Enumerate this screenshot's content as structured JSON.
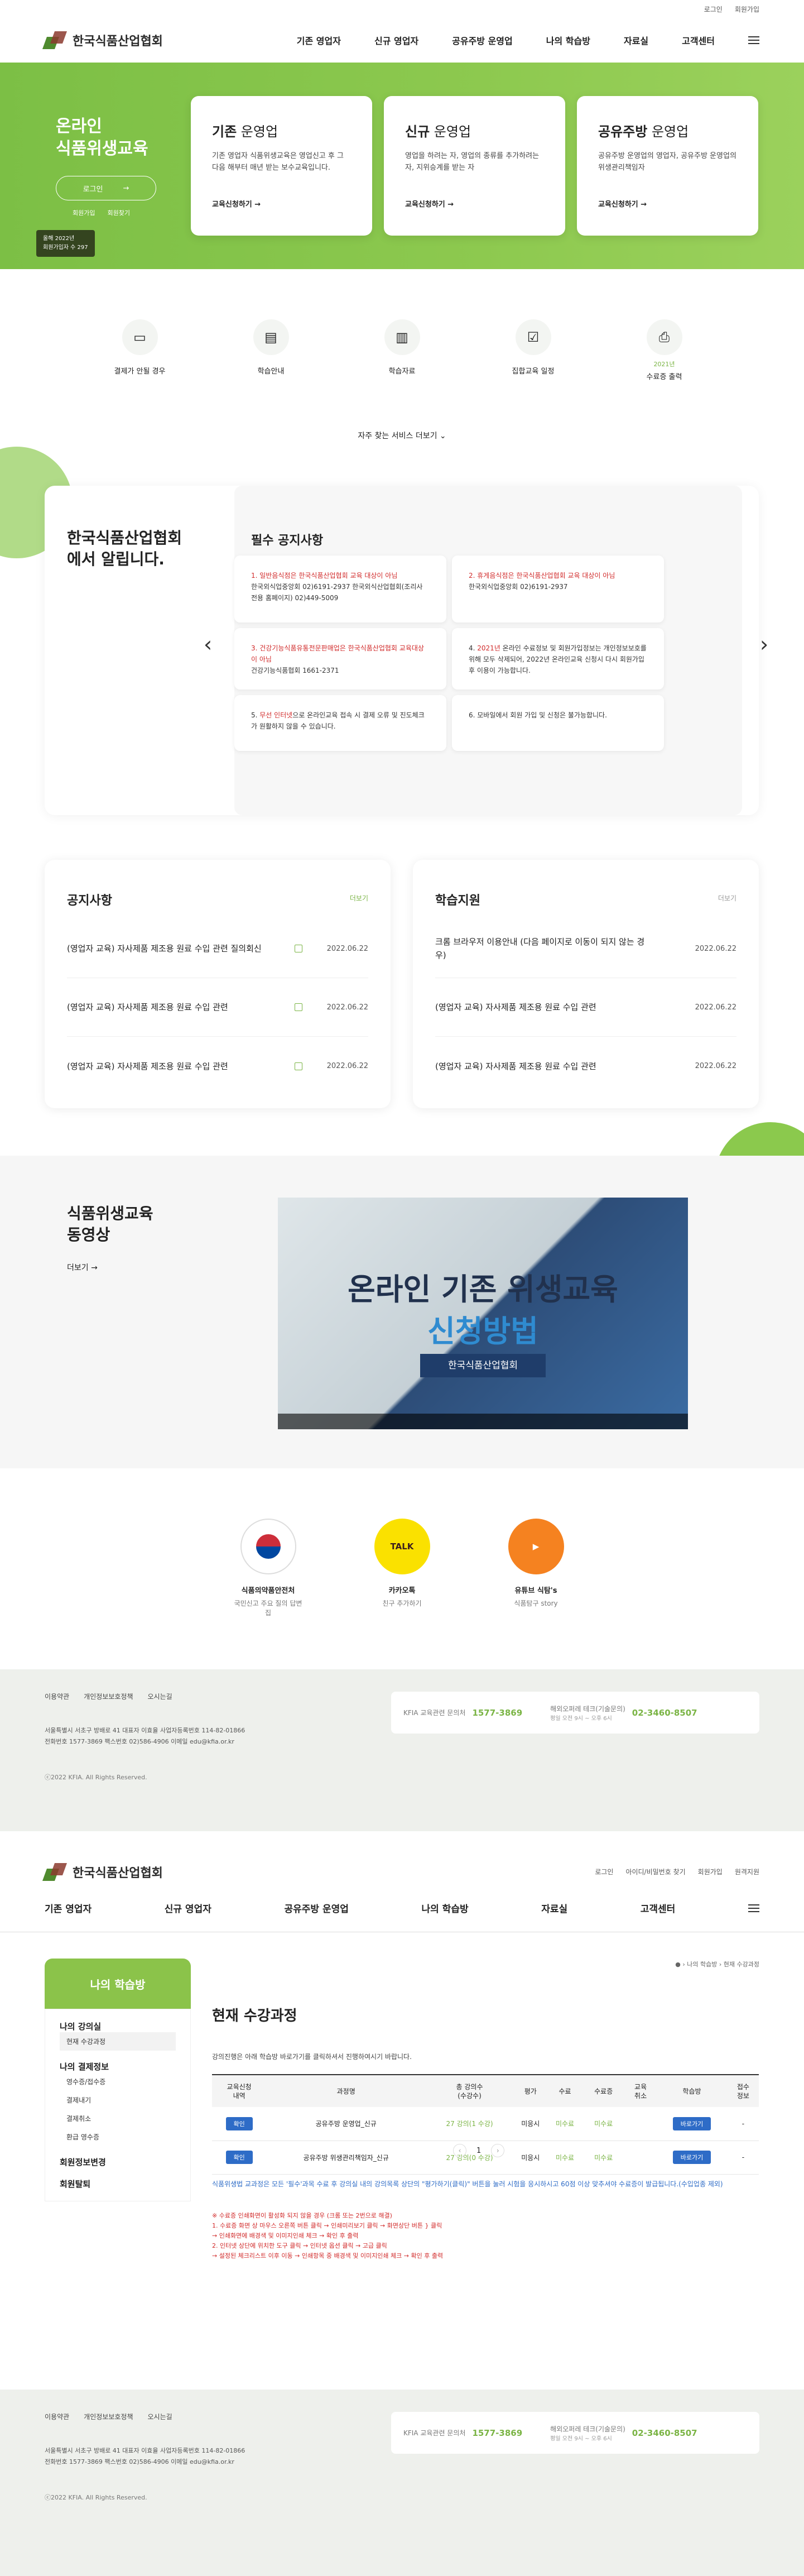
{
  "util": {
    "login": "로그인",
    "join": "회원가입"
  },
  "brand": {
    "name": "한국식품산업협회"
  },
  "gnb": [
    "기존 영업자",
    "신규 영업자",
    "공유주방 운영업",
    "나의 학습방",
    "자료실",
    "고객센터"
  ],
  "hero": {
    "title": "온라인\n식품위생교육",
    "login": "로그인",
    "links": [
      "회원가입",
      "회원찾기"
    ],
    "stat": "올해 2022년\n회원가입자 수 297",
    "cards": [
      {
        "title_b": "기존",
        "title_n": " 운영업",
        "desc": "기존 영업자 식품위생교육은 영업신고 후 그 다음 해부터 매년 받는 보수교육입니다.",
        "link": "교육신청하기 →"
      },
      {
        "title_b": "신규",
        "title_n": " 운영업",
        "desc": "영업을 하려는 자, 영업의 종류를 추가하려는 자, 지위승계를 받는 자",
        "link": "교육신청하기 →"
      },
      {
        "title_b": "공유주방",
        "title_n": " 운영업",
        "desc": "공유주방 운영업의 영업자, 공유주방 운영업의 위생관리책임자",
        "link": "교육신청하기 →"
      }
    ]
  },
  "quick": {
    "items": [
      {
        "label": "결제가 안될 경우",
        "icon": "chat-icon"
      },
      {
        "label": "학습안내",
        "icon": "notebook-icon"
      },
      {
        "label": "학습자료",
        "icon": "document-icon"
      },
      {
        "label": "집합교육 일정",
        "icon": "calendar-check-icon"
      },
      {
        "label": "수료증 출력",
        "icon": "printer-icon",
        "year": "2021년"
      }
    ],
    "more": "자주 찾는 서비스 더보기 ⌄"
  },
  "notice": {
    "title": "한국식품산업협회\n에서 알립니다.",
    "box_title": "필수 공지사항",
    "items": [
      {
        "red": "1. 일반음식점은 한국식품산업협회 교육 대상이 아님",
        "body": "한국외식업중앙회 02)6191-2937\n한국외식산업협회(조리사 전용 홈페이지) 02)449-5009"
      },
      {
        "red": "2. 휴게음식점은 한국식품산업협회 교육 대상이 아님",
        "body": "한국외식업중앙회 02)6191-2937"
      },
      {
        "red": "3. 건강기능식품유통전문판매업은 한국식품산업협회 교육대상이 아님",
        "body": "건강기능식품협회 1661-2371"
      },
      {
        "pre": "4. ",
        "red": "2021년",
        "body": " 온라인 수료정보 및 회원가입정보는 개인정보보호를 위해 모두 삭제되어, 2022년 온라인교육 신청시 다시 회원가입 후 이용이 가능합니다."
      },
      {
        "pre": "5. ",
        "red": "무선 인터넷",
        "body": "으로 온라인교육 접속 시 결제 오류 및 진도체크가 원활하지 않을 수 있습니다."
      },
      {
        "pre": "6. ",
        "red": "",
        "body": "모바일에서 회원 가입 및 신청은 불가능합니다."
      }
    ]
  },
  "boards": [
    {
      "title": "공지사항",
      "more": "더보기",
      "rows": [
        {
          "t": "(영업자 교육) 자사제품 제조용 원료 수입 관련 질의회신",
          "d": "2022.06.22"
        },
        {
          "t": "(영업자 교육) 자사제품 제조용 원료 수입 관련",
          "d": "2022.06.22"
        },
        {
          "t": "(영업자 교육) 자사제품 제조용 원료 수입 관련",
          "d": "2022.06.22"
        }
      ]
    },
    {
      "title": "학습지원",
      "more": "더보기",
      "rows": [
        {
          "t": "크롬 브라우저 이용안내 (다음 페이지로 이동이 되지 않는 경우)",
          "d": "2022.06.22"
        },
        {
          "t": "(영업자 교육) 자사제품 제조용 원료 수입 관련",
          "d": "2022.06.22"
        },
        {
          "t": "(영업자 교육) 자사제품 제조용 원료 수입 관련",
          "d": "2022.06.22"
        }
      ]
    }
  ],
  "video": {
    "title": "식품위생교육\n동영상",
    "more": "더보기 →",
    "v1": "온라인 기존 위생교육",
    "v2": "신청방법",
    "v3": "한국식품산업협회"
  },
  "sns": [
    {
      "t": "식품의약품안전처",
      "s": "국민신고 주요 질의 답변집",
      "icon": "kfda-icon"
    },
    {
      "t": "카카오톡",
      "s": "친구 추가하기",
      "icon": "kakao-talk-icon"
    },
    {
      "t": "유튜브 식탐's",
      "s": "식품탐구 story",
      "icon": "youtube-icon"
    }
  ],
  "footer": {
    "links": [
      "이용약관",
      "개인정보보호정책",
      "오시는길"
    ],
    "info": "서울특별시 서초구 방배로 41    대표자 이효율    사업자등록번호 114-82-01866\n전화번호 1577-3869    팩스번호 02)586-4906    이메일 edu@kfia.or.kr",
    "copy": "ⓒ2022 KFIA. All Rights Reserved.",
    "c1": "KFIA 교육관련 문의처",
    "c1n": "1577-3869",
    "c2": "해외오퍼레 테크(기술문의)",
    "c2n": "02-3460-8507",
    "c2s": "평일 오전 9시 ~ 오후 6시"
  },
  "page2": {
    "util": [
      "로그인",
      "아이디/비밀번호 찾기",
      "회원가입",
      "원격지원"
    ],
    "crumb": "● › 나의 학습방 › 현재 수강과정",
    "snb_title": "나의 학습방",
    "snb": [
      {
        "g": "나의 강의실",
        "items": [
          "현재 수강과정"
        ]
      },
      {
        "g": "나의 결제정보",
        "items": [
          "영수증/접수증",
          "결제내기",
          "결제취소",
          "환급 영수증"
        ]
      },
      {
        "g": "회원정보변경",
        "items": []
      },
      {
        "g": "회원탈퇴",
        "items": []
      }
    ],
    "title": "현재 수강과정",
    "desc": "강의진행은 아래 학습방 바로가기를 클릭하셔서 진행하여시기 바랍니다.",
    "cols": [
      "교육신청\n내역",
      "과정명",
      "총 강의수\n(수강수)",
      "평가",
      "수료",
      "수료증",
      "교육\n취소",
      "학습방",
      "접수\n정보"
    ],
    "rows": [
      {
        "badge": "확인",
        "name": "공유주방 운영업_신규",
        "cnt": "27 강의(1 수강)",
        "eval": "미응시",
        "done": "미수료",
        "cert": "미수료",
        "btn": "바로가기",
        "info": "-"
      },
      {
        "badge": "확인",
        "name": "공유주방 위생관리책임자_신규",
        "cnt": "27 강의(0 수강)",
        "eval": "미응시",
        "done": "미수료",
        "cert": "미수료",
        "btn": "바로가기",
        "info": "-"
      }
    ],
    "page": "1",
    "note1": "식품위생법 교과정은 모든 '필수'과목 수료 후 강의실 내의 강의목록 상단의 \"평가하기(클릭)\" 버튼을 눌러 시험을 응시하시고 60점 이상 맞추셔야 수료증이 발급됩니다.(수입업종 제외)",
    "note2": "※ 수료증 인쇄화면이 활성화 되지 않을 경우 (크롬 또는 2번으로 해결)\n  1. 수료증 화면 상 마우스 오른쪽 버튼 클릭 → 인쇄미리보기 클릭 → 화면상단 버튼 } 클릭\n    → 인쇄화면에 배경색 및 이미지인쇄 체크 → 확인 후 출력\n  2. 인터넷 상단에 위치한 도구 클릭 → 인터넷 옵션 클릭 → 고급 클릭\n    → 설정된 체크리스트 이후 이동 → 인쇄항목 중 배경색 및 이미지인쇄 체크 → 확인 후 출력"
  }
}
